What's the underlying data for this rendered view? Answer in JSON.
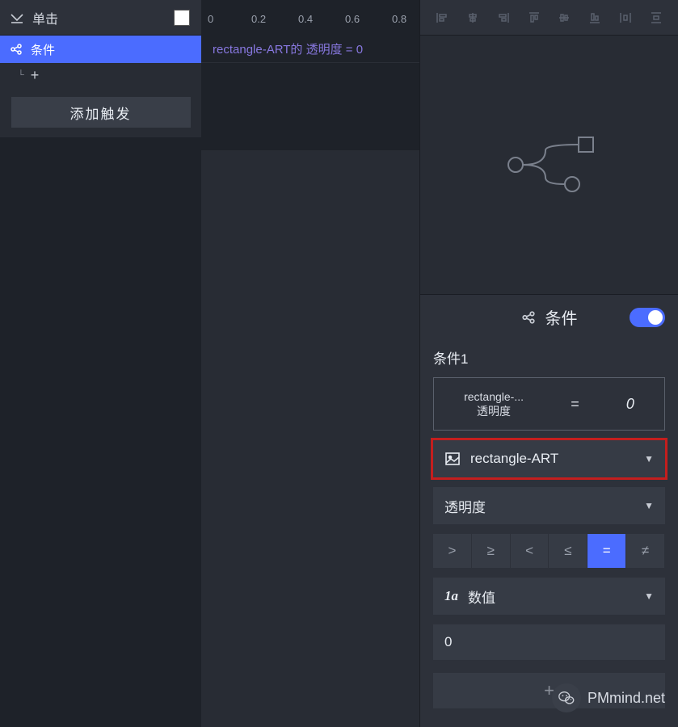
{
  "left": {
    "trigger_label": "单击",
    "condition_label": "条件",
    "add_symbol": "+",
    "add_trigger_btn": "添加触发"
  },
  "middle": {
    "ruler_ticks": [
      "0",
      "0.2",
      "0.4",
      "0.6",
      "0.8"
    ],
    "formula": "rectangle-ART的 透明度 = 0"
  },
  "right": {
    "section_title": "条件",
    "condition_index": "条件1",
    "expr_left_line1": "rectangle-...",
    "expr_left_line2": "透明度",
    "expr_eq": "=",
    "expr_val": "0",
    "target_dd_label": "rectangle-ART",
    "property_dd_label": "透明度",
    "operators": [
      ">",
      "≥",
      "<",
      "≤",
      "=",
      "≠"
    ],
    "operator_active": "=",
    "type_prefix": "1a",
    "type_dd_label": "数值",
    "value_input": "0",
    "watermark": "PMmind.net"
  }
}
